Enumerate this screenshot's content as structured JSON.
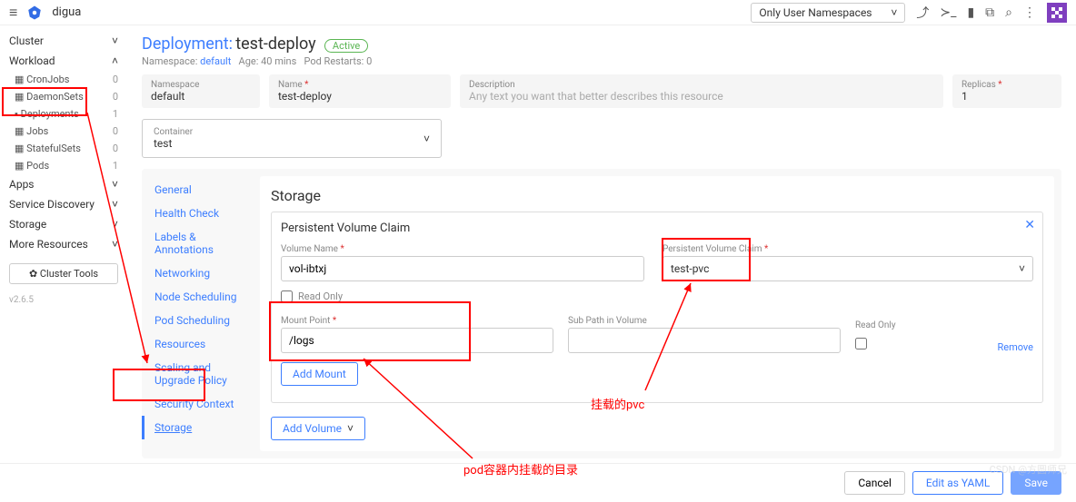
{
  "topbar": {
    "cluster_name": "digua",
    "namespace_filter": "Only User Namespaces"
  },
  "sidebar": {
    "groups": [
      {
        "label": "Cluster",
        "expand": "˅"
      },
      {
        "label": "Workload",
        "expand": "˄"
      }
    ],
    "workload_items": [
      {
        "label": "CronJobs",
        "count": "0"
      },
      {
        "label": "DaemonSets",
        "count": "0"
      },
      {
        "label": "Deployments",
        "count": "1"
      },
      {
        "label": "Jobs",
        "count": "0"
      },
      {
        "label": "StatefulSets",
        "count": "0"
      },
      {
        "label": "Pods",
        "count": "1"
      }
    ],
    "other_groups": [
      {
        "label": "Apps",
        "expand": "˅"
      },
      {
        "label": "Service Discovery",
        "expand": "˅"
      },
      {
        "label": "Storage",
        "expand": "˅"
      },
      {
        "label": "More Resources",
        "expand": "˅"
      }
    ],
    "cluster_tools": "✿ Cluster Tools",
    "version": "v2.6.5"
  },
  "header": {
    "resource_type": "Deployment:",
    "resource_name": "test-deploy",
    "status_badge": "Active",
    "meta_namespace_label": "Namespace:",
    "meta_namespace_value": "default",
    "meta_age_label": "Age:",
    "meta_age_value": "40 mins",
    "meta_restarts_label": "Pod Restarts:",
    "meta_restarts_value": "0"
  },
  "top_fields": {
    "namespace_label": "Namespace",
    "namespace_value": "default",
    "name_label": "Name",
    "name_value": "test-deploy",
    "desc_label": "Description",
    "desc_placeholder": "Any text you want that better describes this resource",
    "replicas_label": "Replicas",
    "replicas_value": "1"
  },
  "container_select": {
    "label": "Container",
    "value": "test"
  },
  "config_tabs": [
    "General",
    "Health Check",
    "Labels & Annotations",
    "Networking",
    "Node Scheduling",
    "Pod Scheduling",
    "Resources",
    "Scaling and Upgrade Policy",
    "Security Context",
    "Storage"
  ],
  "storage_section": {
    "title": "Storage",
    "pvc_title": "Persistent Volume Claim",
    "volume_name_label": "Volume Name",
    "volume_name_value": "vol-ibtxj",
    "pvc_select_label": "Persistent Volume Claim",
    "pvc_select_value": "test-pvc",
    "read_only_vol": "Read Only",
    "mount_point_label": "Mount Point",
    "mount_point_value": "/logs",
    "subpath_label": "Sub Path in Volume",
    "subpath_value": "",
    "read_only_mount": "Read Only",
    "remove_link": "Remove",
    "add_mount_btn": "Add Mount",
    "add_volume_btn": "Add Volume"
  },
  "footer": {
    "cancel": "Cancel",
    "edit_yaml": "Edit as YAML",
    "save": "Save"
  },
  "annotations": {
    "pvc_label": "挂载的pvc",
    "mount_label": "pod容器内挂载的目录"
  },
  "watermark": "CSDN @方圆师兄"
}
